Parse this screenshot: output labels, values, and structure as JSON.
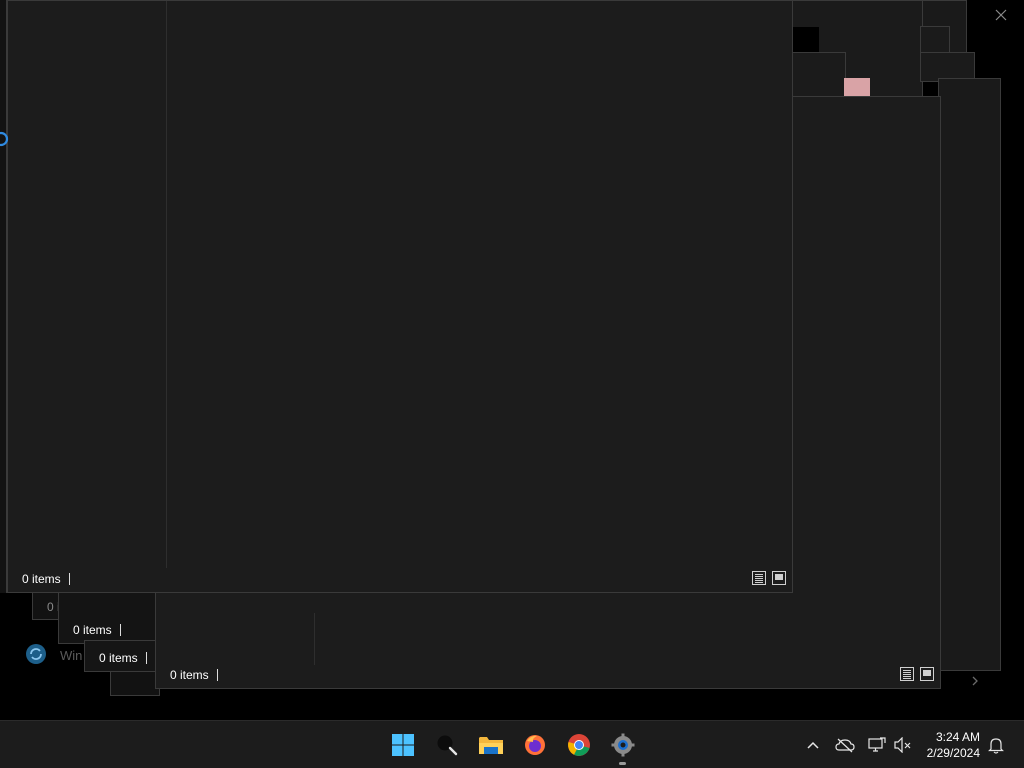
{
  "windows": [
    {
      "status": "0 items"
    },
    {
      "status": "0 items"
    },
    {
      "status": "0 items"
    },
    {
      "status": "0 items"
    },
    {
      "status": "0 i"
    }
  ],
  "background_item": {
    "label": "Win"
  },
  "taskbar": {
    "apps": [
      {
        "name": "Start",
        "icon": "windows-logo-icon"
      },
      {
        "name": "Search",
        "icon": "search-icon"
      },
      {
        "name": "File Explorer",
        "icon": "folder-icon"
      },
      {
        "name": "Firefox",
        "icon": "firefox-icon"
      },
      {
        "name": "Chrome",
        "icon": "chrome-icon"
      },
      {
        "name": "Settings",
        "icon": "gear-icon"
      }
    ],
    "tray": {
      "time": "3:24 AM",
      "date": "2/29/2024"
    }
  },
  "colors": {
    "window_bg": "#1c1c1c",
    "taskbar_bg": "#1c1c1c",
    "accent": "#0078d4"
  }
}
